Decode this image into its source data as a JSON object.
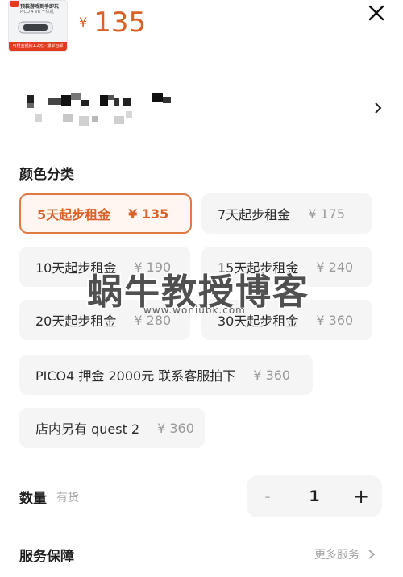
{
  "product": {
    "thumb_title": "预装游戏到手即玩",
    "thumb_sub": "PICO 4 VR 一体机",
    "thumb_strip": "可租金抵扣1.2元 · 爆单包邮",
    "price_symbol": "¥",
    "price": "135"
  },
  "sections": {
    "color_title": "颜色分类",
    "quantity_title": "数量",
    "stock_status": "有货",
    "service_title": "服务保障",
    "more_services": "更多服务"
  },
  "options": [
    {
      "label": "5天起步租金",
      "price": "¥ 135",
      "selected": true
    },
    {
      "label": "7天起步租金",
      "price": "¥ 175"
    },
    {
      "label": "10天起步租金",
      "price": "¥ 190"
    },
    {
      "label": "15天起步租金",
      "price": "¥ 240"
    },
    {
      "label": "20天起步租金",
      "price": "¥ 280"
    },
    {
      "label": "30天起步租金",
      "price": "¥ 360"
    },
    {
      "label": "PICO4 押金 2000元 联系客服拍下",
      "price": "¥ 360"
    },
    {
      "label": "店内另有 quest 2",
      "price": "¥ 360"
    }
  ],
  "quantity": {
    "minus": "-",
    "value": "1",
    "plus": "+"
  },
  "watermark": {
    "main": "蜗牛教授博客",
    "url": "www.woniubk.com"
  },
  "colors": {
    "accent": "#d9622a",
    "accent_border": "#e07a45",
    "option_bg": "#f5f5f5"
  }
}
